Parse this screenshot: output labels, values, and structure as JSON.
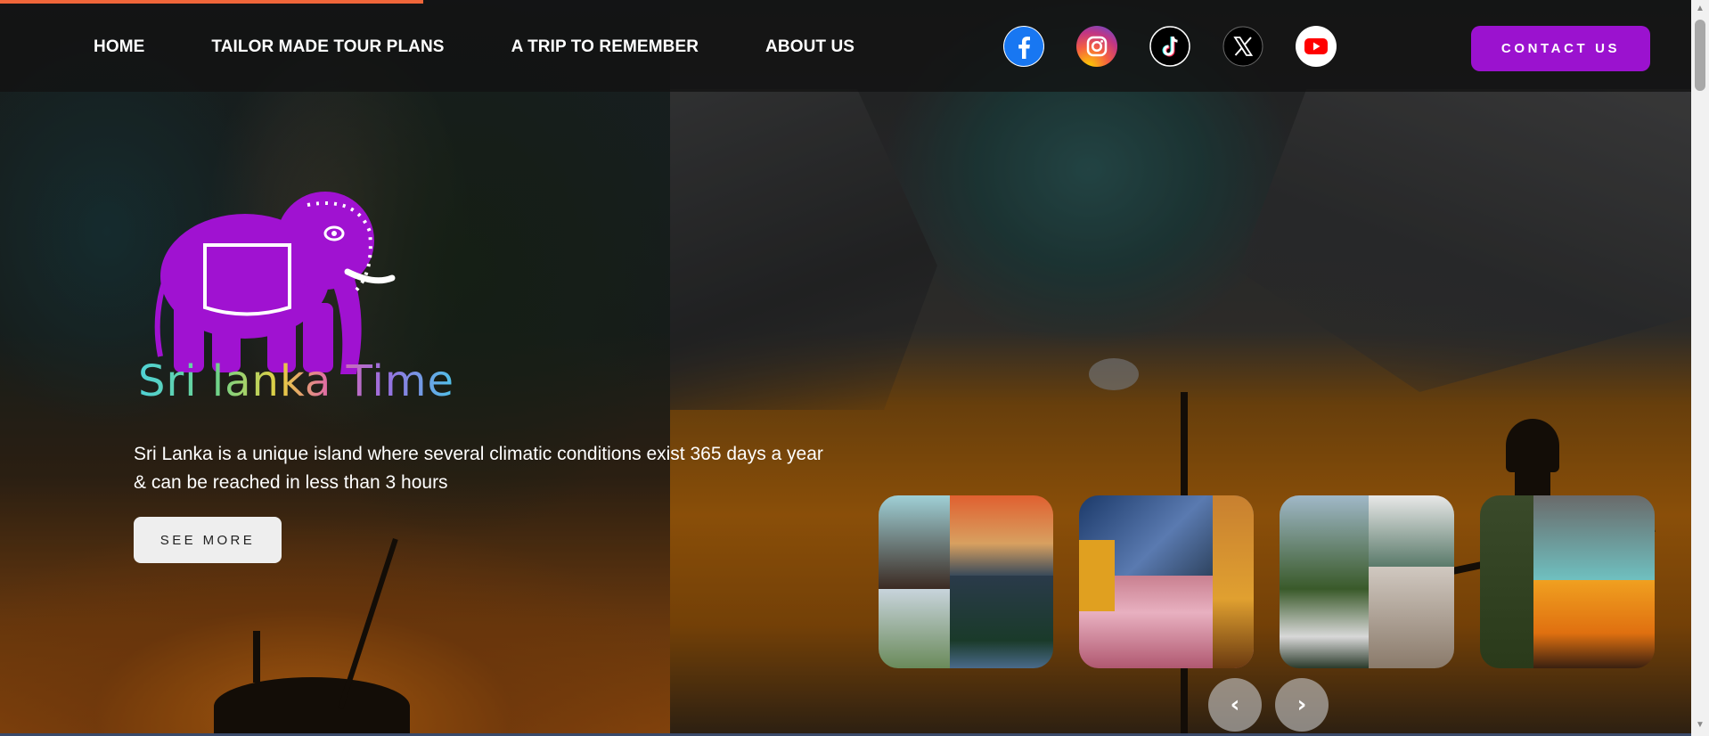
{
  "nav": {
    "links": [
      "HOME",
      "TAILOR MADE TOUR PLANS",
      "A TRIP TO REMEMBER",
      "ABOUT US"
    ],
    "contact_label": "CONTACT US"
  },
  "socials": [
    {
      "name": "facebook-icon",
      "color": "#1877f2"
    },
    {
      "name": "instagram-icon",
      "color": "#e1306c"
    },
    {
      "name": "tiktok-icon",
      "color": "#000000"
    },
    {
      "name": "x-icon",
      "color": "#000000"
    },
    {
      "name": "youtube-icon",
      "color": "#ff0000"
    }
  ],
  "brand": {
    "logo_text": "Sri lanka Time",
    "elephant_color": "#a012d1"
  },
  "hero": {
    "tagline": "Sri Lanka is a unique island where several climatic conditions exist 365 days a year & can be reached in less than 3 hours",
    "see_more_label": "SEE MORE"
  },
  "carousel": {
    "thumbnails": [
      "thumbnail-1",
      "thumbnail-2",
      "thumbnail-3",
      "thumbnail-4"
    ],
    "prev_label": "‹",
    "next_label": "›"
  },
  "colors": {
    "accent": "#9b12cf",
    "progress": "#f0663a"
  }
}
